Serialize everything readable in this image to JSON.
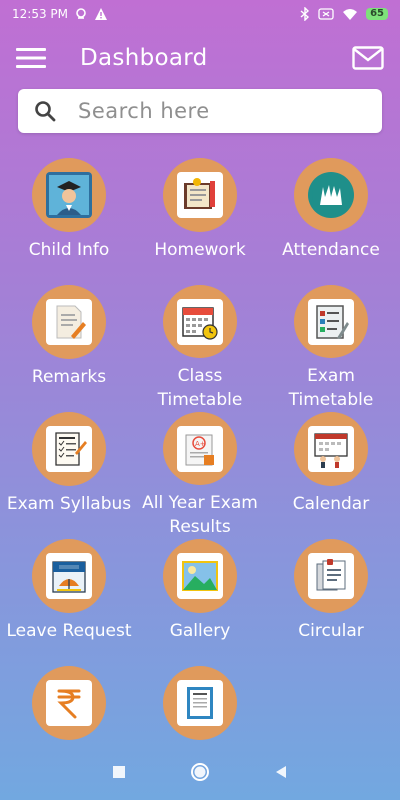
{
  "status_bar": {
    "time": "12:53 PM",
    "battery": "65"
  },
  "app_bar": {
    "title": "Dashboard"
  },
  "search": {
    "placeholder": "Search here"
  },
  "tiles": [
    {
      "label": "Child Info",
      "icon": "student-icon"
    },
    {
      "label": "Homework",
      "icon": "homework-icon"
    },
    {
      "label": "Attendance",
      "icon": "attendance-icon"
    },
    {
      "label": "Remarks",
      "icon": "remarks-icon"
    },
    {
      "label": "Class Timetable",
      "icon": "class-timetable-icon"
    },
    {
      "label": "Exam Timetable",
      "icon": "exam-timetable-icon"
    },
    {
      "label": "Exam Syllabus",
      "icon": "exam-syllabus-icon"
    },
    {
      "label": "All Year Exam Results",
      "icon": "exam-results-icon"
    },
    {
      "label": "Calendar",
      "icon": "calendar-icon"
    },
    {
      "label": "Leave Request",
      "icon": "leave-icon"
    },
    {
      "label": "Gallery",
      "icon": "gallery-icon"
    },
    {
      "label": "Circular",
      "icon": "circular-icon"
    },
    {
      "label": "",
      "icon": "fees-icon"
    },
    {
      "label": "",
      "icon": "receipt-icon"
    }
  ],
  "colors": {
    "tile_circle": "#e09a5c",
    "gradient_top": "#c06fd3",
    "gradient_bottom": "#72a8e0"
  }
}
